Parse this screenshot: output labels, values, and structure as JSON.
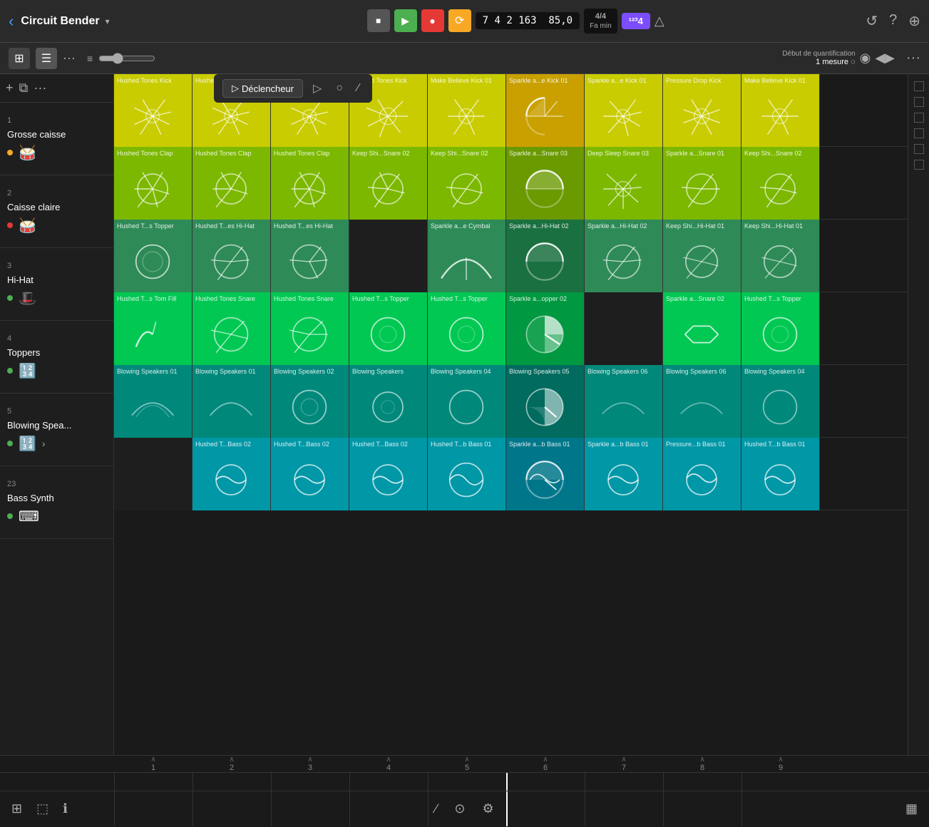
{
  "app": {
    "title": "Circuit Bender",
    "back_label": "‹",
    "chevron": "▾"
  },
  "transport": {
    "stop_label": "■",
    "play_label": "▶",
    "record_label": "●",
    "loop_label": "⟳",
    "position": "7  4  2  163",
    "tempo": "85,0",
    "time_sig_top": "4/4",
    "time_sig_bottom": "Fa min",
    "key_badge": "¹²³4",
    "tuner": "△"
  },
  "toolbar": {
    "grid_icon": "⊞",
    "list_icon": "☰",
    "more": "···",
    "eq_icon": "≡",
    "add": "+",
    "copy": "⧉"
  },
  "trigger_bar": {
    "play_icon": "▷",
    "trigger_label": "Déclencheur",
    "icon1": "▷",
    "icon2": "○",
    "icon3": "∕"
  },
  "quantize": {
    "label": "Début de quantification",
    "value": "1 mesure ◌"
  },
  "top_right": {
    "icon1": "↺",
    "icon2": "?",
    "icon3": "⊕",
    "more": "···",
    "vol": "◀▶"
  },
  "tracks": [
    {
      "number": "1",
      "name": "Grosse caisse",
      "dot_color": "#f9a825",
      "icon": "🥁"
    },
    {
      "number": "2",
      "name": "Caisse claire",
      "dot_color": "#e53935",
      "icon": "🥁"
    },
    {
      "number": "3",
      "name": "Hi-Hat",
      "dot_color": "#4caf50",
      "icon": "🎩"
    },
    {
      "number": "4",
      "name": "Toppers",
      "dot_color": "#4caf50",
      "icon": "🔢"
    },
    {
      "number": "5",
      "name": "Blowing Spea...",
      "dot_color": "#4caf50",
      "icon": "🔢"
    },
    {
      "number": "23",
      "name": "Bass Synth",
      "dot_color": "#4caf50",
      "icon": "⌨"
    }
  ],
  "clips": {
    "row0": [
      {
        "label": "Hushed Tones Kick",
        "color": "yellow",
        "wave": "starburst"
      },
      {
        "label": "Hushed Tones Kick",
        "color": "yellow",
        "wave": "starburst"
      },
      {
        "label": "Hushed Tones Kick",
        "color": "yellow",
        "wave": "starburst"
      },
      {
        "label": "Hushed Tones Kick",
        "color": "yellow",
        "wave": "starburst"
      },
      {
        "label": "Make Believe Kick 01",
        "color": "yellow",
        "wave": "starburst2"
      },
      {
        "label": "Sparkle a...e Kick 01",
        "color": "yellow-half",
        "wave": "half-circle"
      },
      {
        "label": "Sparkle a...e Kick 01",
        "color": "yellow",
        "wave": "starburst"
      },
      {
        "label": "Pressure Drop Kick",
        "color": "yellow",
        "wave": "starburst"
      },
      {
        "label": "Make Believe Kick 01",
        "color": "yellow",
        "wave": "starburst"
      }
    ],
    "row1": [
      {
        "label": "Hushed Tones Clap",
        "color": "lime",
        "wave": "circle-burst"
      },
      {
        "label": "Hushed Tones Clap",
        "color": "lime",
        "wave": "circle-burst"
      },
      {
        "label": "Hushed Tones Clap",
        "color": "lime",
        "wave": "circle-burst"
      },
      {
        "label": "Keep Shi...Snare 02",
        "color": "lime",
        "wave": "circle-burst"
      },
      {
        "label": "Keep Shi...Snare 02",
        "color": "lime",
        "wave": "circle-burst"
      },
      {
        "label": "Sparkle a...Snare 03",
        "color": "lime-half",
        "wave": "half-circle"
      },
      {
        "label": "Deep Sleep Snare 03",
        "color": "lime",
        "wave": "starburst"
      },
      {
        "label": "Sparkle a...Snare 01",
        "color": "lime",
        "wave": "circle-burst"
      },
      {
        "label": "Keep Shi...Snare 02",
        "color": "lime",
        "wave": "circle-burst"
      }
    ],
    "row2": [
      {
        "label": "Hushed T...s Topper",
        "color": "green",
        "wave": "circle"
      },
      {
        "label": "Hushed T...es Hi-Hat",
        "color": "green",
        "wave": "circle-burst"
      },
      {
        "label": "Hushed T...es Hi-Hat",
        "color": "green",
        "wave": "circle-burst"
      },
      {
        "label": "",
        "color": "empty"
      },
      {
        "label": "Sparkle a...e Cymbal",
        "color": "green",
        "wave": "horn"
      },
      {
        "label": "Sparkle a...Hi-Hat 02",
        "color": "green-half",
        "wave": "half-circle"
      },
      {
        "label": "Sparkle a...Hi-Hat 02",
        "color": "green",
        "wave": "circle-burst"
      },
      {
        "label": "Keep Shi...Hi-Hat 01",
        "color": "green",
        "wave": "circle-burst"
      },
      {
        "label": "Keep Shi...Hi-Hat 01",
        "color": "green",
        "wave": "circle-burst"
      }
    ],
    "row3": [
      {
        "label": "Hushed T...s Tom Fill",
        "color": "green2",
        "wave": "arc"
      },
      {
        "label": "Hushed Tones Snare",
        "color": "green2",
        "wave": "circle-burst2"
      },
      {
        "label": "Hushed Tones Snare",
        "color": "green2",
        "wave": "circle-burst2"
      },
      {
        "label": "Hushed T...s Topper",
        "color": "green2",
        "wave": "circle"
      },
      {
        "label": "Hushed T...s Topper",
        "color": "green2",
        "wave": "circle"
      },
      {
        "label": "Sparkle a...opper 02",
        "color": "green2-half",
        "wave": "half-circle"
      },
      {
        "label": "",
        "color": "empty"
      },
      {
        "label": "Sparkle a...Snare 02",
        "color": "green2",
        "wave": "lines"
      },
      {
        "label": "Hushed T...s Topper",
        "color": "green2",
        "wave": "circle"
      }
    ],
    "row4": [
      {
        "label": "Blowing Speakers 01",
        "color": "teal",
        "wave": "arc-small"
      },
      {
        "label": "Blowing Speakers 01",
        "color": "teal",
        "wave": "arc-small"
      },
      {
        "label": "Blowing Speakers 02",
        "color": "teal",
        "wave": "circle"
      },
      {
        "label": "Blowing Speakers",
        "color": "teal",
        "wave": "circle"
      },
      {
        "label": "Blowing Speakers 04",
        "color": "teal",
        "wave": "circle"
      },
      {
        "label": "Blowing Speakers 05",
        "color": "teal-half",
        "wave": "pie-chart"
      },
      {
        "label": "Blowing Speakers 06",
        "color": "teal",
        "wave": "arc-small"
      },
      {
        "label": "Blowing Speakers 06",
        "color": "teal",
        "wave": "arc-small"
      },
      {
        "label": "Blowing Speakers 04",
        "color": "teal",
        "wave": "arc-small"
      }
    ],
    "row5": [
      {
        "label": "",
        "color": "empty"
      },
      {
        "label": "Hushed T...Bass 02",
        "color": "cyan",
        "wave": "waveform"
      },
      {
        "label": "Hushed T...Bass 02",
        "color": "cyan",
        "wave": "waveform"
      },
      {
        "label": "Hushed T...Bass 02",
        "color": "cyan",
        "wave": "waveform"
      },
      {
        "label": "Hushed T...b Bass 01",
        "color": "cyan",
        "wave": "waveform"
      },
      {
        "label": "Sparkle a...b Bass 01",
        "color": "cyan-half",
        "wave": "half-circle-wave"
      },
      {
        "label": "Sparkle a...b Bass 01",
        "color": "cyan",
        "wave": "waveform"
      },
      {
        "label": "Pressure...b Bass 01",
        "color": "cyan",
        "wave": "waveform"
      },
      {
        "label": "Hushed T...b Bass 01",
        "color": "cyan",
        "wave": "waveform"
      }
    ]
  },
  "timeline": {
    "numbers": [
      "1",
      "2",
      "3",
      "4",
      "5",
      "6",
      "7",
      "8",
      "9"
    ]
  },
  "bottom_controls": {
    "icon1": "⊞",
    "icon2": "⬚",
    "icon3": "ℹ",
    "center1": "∕",
    "center2": "⊙",
    "center3": "⚙",
    "right": "▦"
  }
}
